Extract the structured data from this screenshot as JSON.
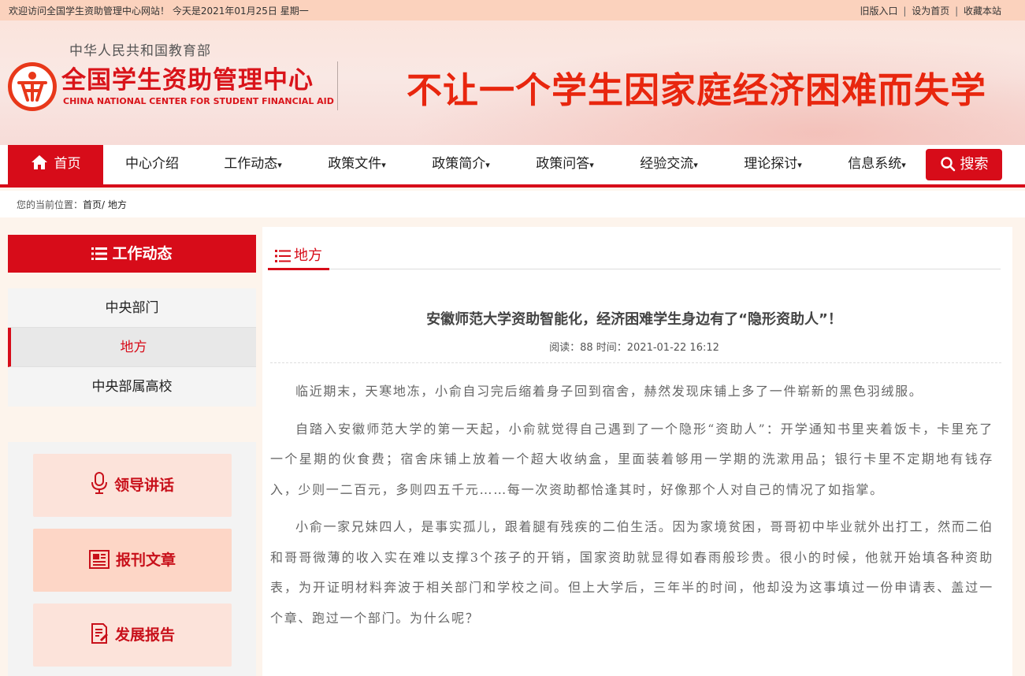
{
  "topbar": {
    "welcome": "欢迎访问全国学生资助管理中心网站！ 今天是2021年01月25日 星期一",
    "links": [
      "旧版入口",
      "设为首页",
      "收藏本站"
    ],
    "separator": "|"
  },
  "header": {
    "ministry": "中华人民共和国教育部",
    "center_name": "全国学生资助管理中心",
    "center_en": "CHINA NATIONAL CENTER FOR STUDENT FINANCIAL AID",
    "slogan": "不让一个学生因家庭经济困难而失学",
    "logo_icon": "logo-emblem-icon",
    "brand_color": "#d70c19"
  },
  "nav": {
    "home": "首页",
    "items": [
      {
        "label": "中心介绍",
        "caret": ""
      },
      {
        "label": "工作动态",
        "caret": "▾"
      },
      {
        "label": "政策文件",
        "caret": "▾"
      },
      {
        "label": "政策简介",
        "caret": "▾"
      },
      {
        "label": "政策问答",
        "caret": "▾"
      },
      {
        "label": "经验交流",
        "caret": "▾"
      },
      {
        "label": "理论探讨",
        "caret": "▾"
      },
      {
        "label": "信息系统",
        "caret": "▾"
      }
    ],
    "search": "搜索"
  },
  "breadcrumb": {
    "prefix": "您的当前位置：",
    "home": "首页/",
    "current": "地方"
  },
  "sidebar": {
    "title": "工作动态",
    "items": [
      {
        "label": "中央部门",
        "active": false
      },
      {
        "label": "地方",
        "active": true
      },
      {
        "label": "中央部属高校",
        "active": false
      }
    ],
    "quick_links": [
      {
        "label": "领导讲话",
        "icon": "microphone-icon"
      },
      {
        "label": "报刊文章",
        "icon": "newspaper-icon"
      },
      {
        "label": "发展报告",
        "icon": "report-icon"
      }
    ]
  },
  "main": {
    "tab": "地方",
    "article": {
      "title": "安徽师范大学资助智能化，经济困难学生身边有了“隐形资助人”！",
      "meta": "阅读：88 时间：2021-01-22 16:12",
      "paragraphs": [
        "临近期末，天寒地冻，小俞自习完后缩着身子回到宿舍，赫然发现床铺上多了一件崭新的黑色羽绒服。",
        "自踏入安徽师范大学的第一天起，小俞就觉得自己遇到了一个隐形“资助人”：开学通知书里夹着饭卡，卡里充了一个星期的伙食费；宿舍床铺上放着一个超大收纳盒，里面装着够用一学期的洗漱用品；银行卡里不定期地有钱存入，少则一二百元，多则四五千元……每一次资助都恰逢其时，好像那个人对自己的情况了如指掌。",
        "小俞一家兄妹四人，是事实孤儿，跟着腿有残疾的二伯生活。因为家境贫困，哥哥初中毕业就外出打工，然而二伯和哥哥微薄的收入实在难以支撑3个孩子的开销，国家资助就显得如春雨般珍贵。很小的时候，他就开始填各种资助表，为开证明材料奔波于相关部门和学校之间。但上大学后，三年半的时间，他却没为这事填过一份申请表、盖过一个章、跑过一个部门。为什么呢？"
      ]
    }
  }
}
